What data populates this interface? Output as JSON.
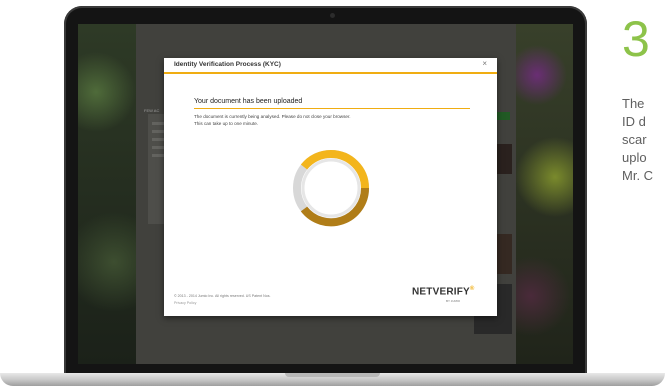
{
  "step_number": "3",
  "side_caption": {
    "lines": [
      "The",
      "ID d",
      "scar",
      "uplo",
      "Mr. C"
    ]
  },
  "modal": {
    "title": "Identity Verification Process (KYC)",
    "close_label": "×",
    "heading": "Your document has been uploaded",
    "message_lines": [
      "The document is currently being analysed. Please do not close your browser.",
      "This can take up to one minute."
    ],
    "footer_copyright": "© 2013 - 2014 Jumio Inc. All rights reserved. US Patent Nos.",
    "footer_privacy": "Privacy Policy",
    "brand_name": "NETVERIFY",
    "brand_sup": "®",
    "brand_sub": "BY JUMIO"
  },
  "background_site": {
    "sidebar_heading": "FEW AC",
    "button_label": ""
  },
  "colors": {
    "accent": "#f0ad12",
    "spinner_dark": "#b07d18",
    "spinner_light": "#f3b51c",
    "step_green": "#8dc34a"
  },
  "icons": [
    "close-icon",
    "loading-spinner-icon"
  ]
}
